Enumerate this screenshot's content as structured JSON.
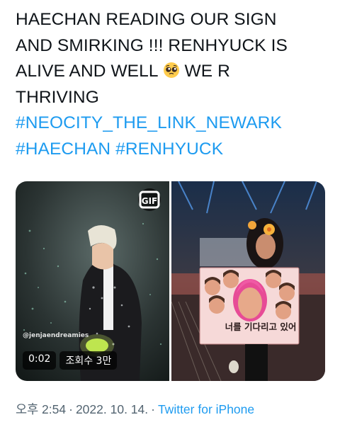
{
  "tweet": {
    "lines": [
      "HAECHAN READING OUR SIGN",
      "AND SMIRKING !!! RENHYUCK IS",
      "ALIVE AND WELL",
      "WE R",
      "THRIVING"
    ],
    "hashtags": [
      "#NEOCITY_THE_LINK_NEWARK",
      "#HAECHAN",
      "#RENHYUCK"
    ],
    "emoji": "pleading-face-emoji"
  },
  "media": {
    "video": {
      "watermark": "@jenjaendreamies",
      "duration": "0:02",
      "views": "조회수 3만",
      "badge_icon": "gif-icon"
    },
    "photo": {
      "sign_text": "너를 기다리고 있어"
    }
  },
  "footer": {
    "time": "오후 2:54",
    "date": "2022. 10. 14.",
    "separator": "·",
    "source": "Twitter for iPhone"
  },
  "colors": {
    "text": "#0f1419",
    "link": "#1d9bf0",
    "meta": "#536471"
  }
}
